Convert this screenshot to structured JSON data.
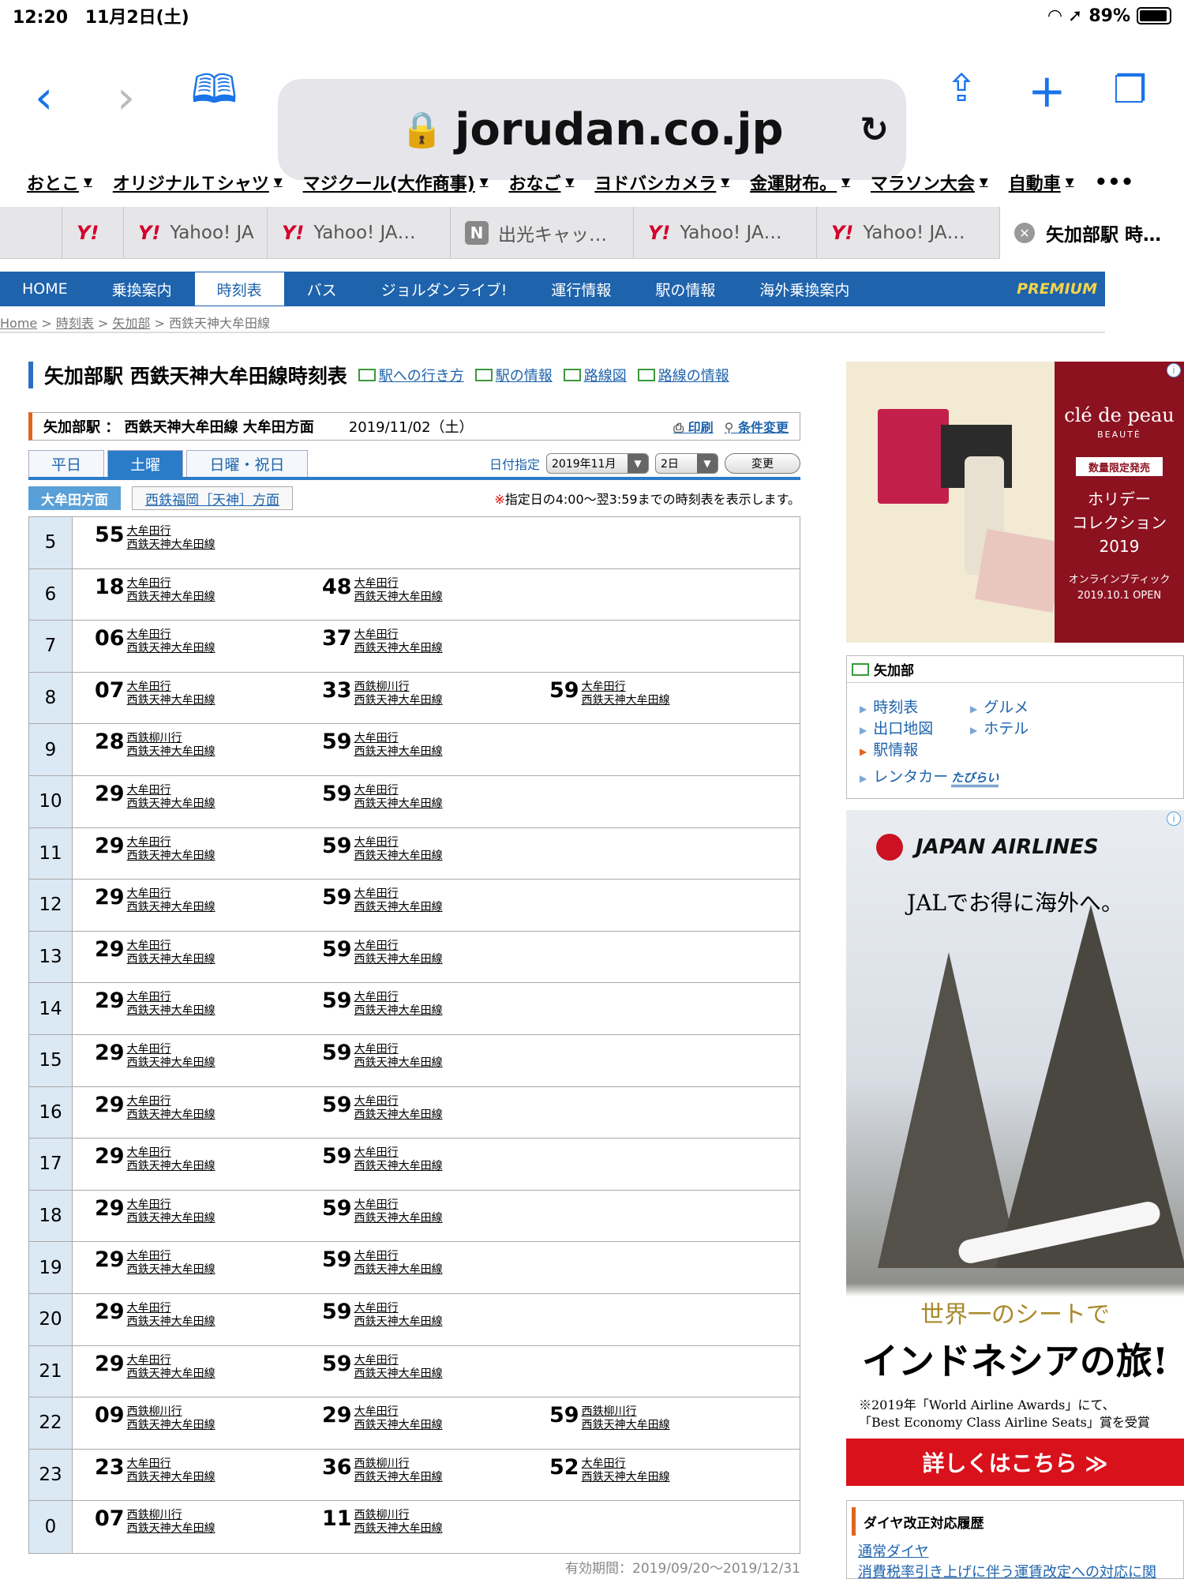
{
  "status": {
    "time": "12:20",
    "date": "11月2日(土)",
    "battery": "89%"
  },
  "browser": {
    "url": "jorudan.co.jp"
  },
  "bookmarks": [
    "おとこ",
    "オリジナルＴシャツ",
    "マジクール(大作商事)",
    "おなご",
    "ヨドバシカメラ",
    "金運財布。",
    "マラソン大会",
    "自動車"
  ],
  "tabs": [
    {
      "label": "",
      "kind": "y"
    },
    {
      "label": "Yahoo! JA",
      "kind": "y"
    },
    {
      "label": "Yahoo! JA…",
      "kind": "y"
    },
    {
      "label": "出光キャッ…",
      "kind": "n"
    },
    {
      "label": "Yahoo! JA…",
      "kind": "y"
    },
    {
      "label": "Yahoo! JA…",
      "kind": "y"
    },
    {
      "label": "矢加部駅 時…",
      "kind": "active"
    }
  ],
  "nav": [
    "HOME",
    "乗換案内",
    "時刻表",
    "バス",
    "ジョルダンライブ!",
    "運行情報",
    "駅の情報",
    "海外乗換案内"
  ],
  "nav_premium": "PREMIUM",
  "breadcrumb": [
    "Home",
    "時刻表",
    "矢加部",
    "西鉄天神大牟田線"
  ],
  "title": "矢加部駅 西鉄天神大牟田線時刻表",
  "title_links": [
    "駅への行き方",
    "駅の情報",
    "路線図",
    "路線の情報"
  ],
  "info": {
    "station": "矢加部駅 ： 西鉄天神大牟田線 大牟田方面",
    "date": "2019/11/02（土）",
    "print": "印刷",
    "change_cond": "条件変更"
  },
  "day_tabs": [
    "平日",
    "土曜",
    "日曜・祝日"
  ],
  "date_select": {
    "label": "日付指定",
    "month": "2019年11月",
    "day": "2日",
    "button": "変更"
  },
  "directions": {
    "active": "大牟田方面",
    "other": "西鉄福岡［天神］方面",
    "note": "指定日の4:00〜翌3:59までの時刻表を表示します。",
    "note_mark": "※"
  },
  "timetable": [
    {
      "hour": "5",
      "deps": [
        {
          "min": "55",
          "dest": "大牟田行",
          "line": "西鉄天神大牟田線"
        }
      ]
    },
    {
      "hour": "6",
      "deps": [
        {
          "min": "18",
          "dest": "大牟田行",
          "line": "西鉄天神大牟田線"
        },
        {
          "min": "48",
          "dest": "大牟田行",
          "line": "西鉄天神大牟田線"
        }
      ]
    },
    {
      "hour": "7",
      "deps": [
        {
          "min": "06",
          "dest": "大牟田行",
          "line": "西鉄天神大牟田線"
        },
        {
          "min": "37",
          "dest": "大牟田行",
          "line": "西鉄天神大牟田線"
        }
      ]
    },
    {
      "hour": "8",
      "deps": [
        {
          "min": "07",
          "dest": "大牟田行",
          "line": "西鉄天神大牟田線"
        },
        {
          "min": "33",
          "dest": "西鉄柳川行",
          "line": "西鉄天神大牟田線"
        },
        {
          "min": "59",
          "dest": "大牟田行",
          "line": "西鉄天神大牟田線"
        }
      ]
    },
    {
      "hour": "9",
      "deps": [
        {
          "min": "28",
          "dest": "西鉄柳川行",
          "line": "西鉄天神大牟田線"
        },
        {
          "min": "59",
          "dest": "大牟田行",
          "line": "西鉄天神大牟田線"
        }
      ]
    },
    {
      "hour": "10",
      "deps": [
        {
          "min": "29",
          "dest": "大牟田行",
          "line": "西鉄天神大牟田線"
        },
        {
          "min": "59",
          "dest": "大牟田行",
          "line": "西鉄天神大牟田線"
        }
      ]
    },
    {
      "hour": "11",
      "deps": [
        {
          "min": "29",
          "dest": "大牟田行",
          "line": "西鉄天神大牟田線"
        },
        {
          "min": "59",
          "dest": "大牟田行",
          "line": "西鉄天神大牟田線"
        }
      ]
    },
    {
      "hour": "12",
      "deps": [
        {
          "min": "29",
          "dest": "大牟田行",
          "line": "西鉄天神大牟田線"
        },
        {
          "min": "59",
          "dest": "大牟田行",
          "line": "西鉄天神大牟田線"
        }
      ]
    },
    {
      "hour": "13",
      "deps": [
        {
          "min": "29",
          "dest": "大牟田行",
          "line": "西鉄天神大牟田線"
        },
        {
          "min": "59",
          "dest": "大牟田行",
          "line": "西鉄天神大牟田線"
        }
      ]
    },
    {
      "hour": "14",
      "deps": [
        {
          "min": "29",
          "dest": "大牟田行",
          "line": "西鉄天神大牟田線"
        },
        {
          "min": "59",
          "dest": "大牟田行",
          "line": "西鉄天神大牟田線"
        }
      ]
    },
    {
      "hour": "15",
      "deps": [
        {
          "min": "29",
          "dest": "大牟田行",
          "line": "西鉄天神大牟田線"
        },
        {
          "min": "59",
          "dest": "大牟田行",
          "line": "西鉄天神大牟田線"
        }
      ]
    },
    {
      "hour": "16",
      "deps": [
        {
          "min": "29",
          "dest": "大牟田行",
          "line": "西鉄天神大牟田線"
        },
        {
          "min": "59",
          "dest": "大牟田行",
          "line": "西鉄天神大牟田線"
        }
      ]
    },
    {
      "hour": "17",
      "deps": [
        {
          "min": "29",
          "dest": "大牟田行",
          "line": "西鉄天神大牟田線"
        },
        {
          "min": "59",
          "dest": "大牟田行",
          "line": "西鉄天神大牟田線"
        }
      ]
    },
    {
      "hour": "18",
      "deps": [
        {
          "min": "29",
          "dest": "大牟田行",
          "line": "西鉄天神大牟田線"
        },
        {
          "min": "59",
          "dest": "大牟田行",
          "line": "西鉄天神大牟田線"
        }
      ]
    },
    {
      "hour": "19",
      "deps": [
        {
          "min": "29",
          "dest": "大牟田行",
          "line": "西鉄天神大牟田線"
        },
        {
          "min": "59",
          "dest": "大牟田行",
          "line": "西鉄天神大牟田線"
        }
      ]
    },
    {
      "hour": "20",
      "deps": [
        {
          "min": "29",
          "dest": "大牟田行",
          "line": "西鉄天神大牟田線"
        },
        {
          "min": "59",
          "dest": "大牟田行",
          "line": "西鉄天神大牟田線"
        }
      ]
    },
    {
      "hour": "21",
      "deps": [
        {
          "min": "29",
          "dest": "大牟田行",
          "line": "西鉄天神大牟田線"
        },
        {
          "min": "59",
          "dest": "大牟田行",
          "line": "西鉄天神大牟田線"
        }
      ]
    },
    {
      "hour": "22",
      "deps": [
        {
          "min": "09",
          "dest": "西鉄柳川行",
          "line": "西鉄天神大牟田線"
        },
        {
          "min": "29",
          "dest": "大牟田行",
          "line": "西鉄天神大牟田線"
        },
        {
          "min": "59",
          "dest": "西鉄柳川行",
          "line": "西鉄天神大牟田線"
        }
      ]
    },
    {
      "hour": "23",
      "deps": [
        {
          "min": "23",
          "dest": "大牟田行",
          "line": "西鉄天神大牟田線"
        },
        {
          "min": "36",
          "dest": "西鉄柳川行",
          "line": "西鉄天神大牟田線"
        },
        {
          "min": "52",
          "dest": "大牟田行",
          "line": "西鉄天神大牟田線"
        }
      ]
    },
    {
      "hour": "0",
      "deps": [
        {
          "min": "07",
          "dest": "西鉄柳川行",
          "line": "西鉄天神大牟田線"
        },
        {
          "min": "11",
          "dest": "西鉄柳川行",
          "line": "西鉄天神大牟田線"
        }
      ]
    }
  ],
  "validity": "有効期間：2019/09/20〜2019/12/31",
  "ad1": {
    "brand": "clé de peau",
    "sub": "BEAUTÉ",
    "tag": "数量限定発売",
    "line1": "ホリデー",
    "line2": "コレクション",
    "line3": "2019",
    "small1": "オンラインブティック",
    "small2": "2019.10.1 OPEN"
  },
  "station_box": {
    "title": "矢加部",
    "links": [
      "時刻表",
      "グルメ",
      "出口地図",
      "ホテル",
      "駅情報",
      "レンタカー"
    ],
    "rental_brand": "たびらい"
  },
  "ad2": {
    "logo": "JAPAN AIRLINES",
    "headline": "JALでお得に海外へ。",
    "tagline": "世界一のシートで",
    "big": "インドネシアの旅!",
    "award1": "※2019年「World Airline Awards」にて、",
    "award2": "「Best Economy Class Airline Seats」賞を受賞",
    "cta": "詳しくはこちら ≫"
  },
  "revision_box": {
    "title": "ダイヤ改正対応履歴",
    "links": [
      "通常ダイヤ",
      "消費税率引き上げに伴う運賃改定への対応に関"
    ]
  }
}
